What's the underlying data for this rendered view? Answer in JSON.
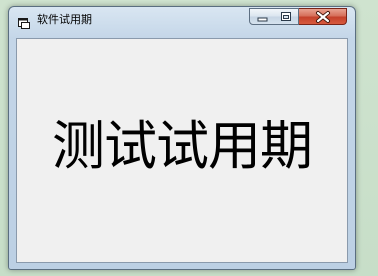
{
  "window": {
    "title": "软件试用期",
    "app_icon": "window-app-icon",
    "controls": {
      "minimize_icon": "minimize-icon",
      "maximize_icon": "maximize-icon",
      "close_icon": "close-icon"
    }
  },
  "form": {
    "label_text": "测试试用期"
  },
  "colors": {
    "desktop": "#c7dec8",
    "client_background": "#f0f0f0",
    "close_button": "#c4412b",
    "frame": "#bcd0e4"
  }
}
